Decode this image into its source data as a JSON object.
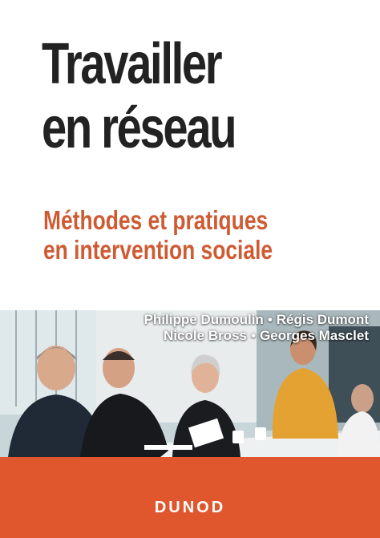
{
  "book": {
    "title_line1": "Travailler",
    "title_line2": "en réseau",
    "subtitle_line1": "Méthodes et pratiques",
    "subtitle_line2": "en intervention sociale",
    "authors_row1": [
      "Philippe Dumoulin",
      "Régis Dumont"
    ],
    "authors_row2": [
      "Nicole Bross",
      "Georges Masclet"
    ],
    "separator": "•",
    "publisher": "DUNOD"
  },
  "colors": {
    "title": "#222222",
    "subtitle": "#cf5b33",
    "footer": "#e1572d"
  }
}
